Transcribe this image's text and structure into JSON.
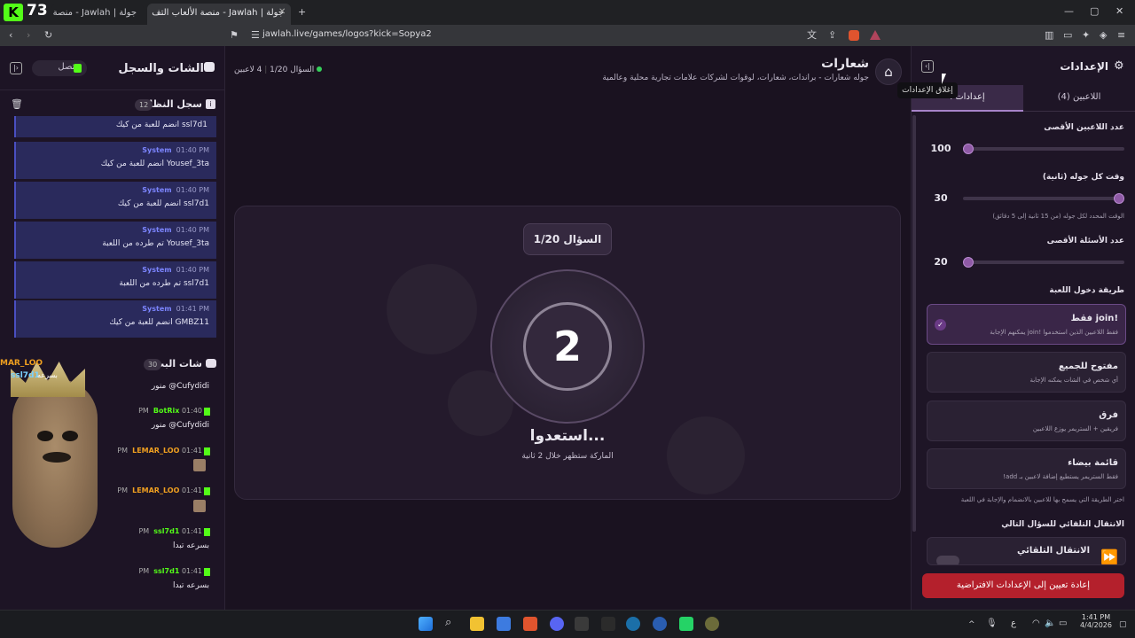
{
  "browser": {
    "logo_text": "73",
    "tabs": [
      {
        "title": "جولة | Jawlah - منصة الألعاب الت"
      },
      {
        "title": "جولة | Jawlah - منصة الألعاب التف"
      }
    ],
    "url": "jawlah.live/games/logos?kick=Sopya2"
  },
  "chat": {
    "title": "الشات والسجل",
    "status": "متصل",
    "system_log": {
      "title": "سجل النظام",
      "count": "12",
      "messages": [
        {
          "sender": "",
          "time": "",
          "text": "ssl7d1 انضم للعبة من كيك"
        },
        {
          "sender": "System",
          "time": "01:40 PM",
          "text": "Yousef_3ta انضم للعبة من كيك"
        },
        {
          "sender": "System",
          "time": "01:40 PM",
          "text": "ssl7d1 انضم للعبة من كيك"
        },
        {
          "sender": "System",
          "time": "01:40 PM",
          "text": "Yousef_3ta تم طرده من اللعبة"
        },
        {
          "sender": "System",
          "time": "01:40 PM",
          "text": "ssl7d1 تم طرده من اللعبة"
        },
        {
          "sender": "System",
          "time": "01:41 PM",
          "text": "GMBZ11 انضم للعبة من كيك"
        }
      ]
    },
    "broadcast": {
      "title": "شات البث",
      "count": "30",
      "overlay_names": [
        "MAR_LOO",
        "ssl7d1"
      ],
      "overlay_text": "بسرعه",
      "messages": [
        {
          "user": "",
          "time": "",
          "text": "Cufydidi@ منور"
        },
        {
          "user": "BotRix",
          "time": "01:40 PM",
          "text": "Cufydidi@ منور"
        },
        {
          "user": "LEMAR_LOO",
          "time": "01:41 PM",
          "text": ""
        },
        {
          "user": "LEMAR_LOO",
          "time": "01:41 PM",
          "text": ""
        },
        {
          "user": "ssl7d1",
          "time": "01:41 PM",
          "text": "بسرعه تبدا"
        },
        {
          "user": "ssl7d1",
          "time": "01:41 PM",
          "text": "بسرعه تبدا"
        }
      ]
    }
  },
  "game": {
    "title": "شعارات",
    "subtitle": "جوله شعارات - براندات، شعارات، لوقوات لشركات علامات تجارية محلية وعالمية",
    "players": "4 لاعبين",
    "question_header": "السؤال 1/20",
    "question_pill": "السؤال 1/20",
    "countdown": "2",
    "ready": "استعدوا...",
    "ready_sub": "الماركة ستظهر خلال 2 ثانية"
  },
  "settings": {
    "title": "الإعدادات",
    "tooltip": "إغلاق الإعدادات",
    "tab_players": "اللاعبين (4)",
    "tab_settings": "إعدادات ا",
    "max_players": {
      "label": "عدد اللاعبين الأقصى",
      "value": "100",
      "level": 0.0
    },
    "round_time": {
      "label": "وقت كل جوله (ثانية)",
      "value": "30",
      "hint": "الوقت المحدد لكل جوله (من 15 ثانية إلى 5 دقائق)",
      "level": 1.0
    },
    "max_questions": {
      "label": "عدد الأسئلة الأقصى",
      "value": "20",
      "level": 0.0
    },
    "join_method_label": "طريقة دخول اللعبة",
    "options": [
      {
        "title": "!join فقط",
        "desc": "فقط اللاعبين الذين استخدموا !join يمكنهم الإجابة",
        "selected": true
      },
      {
        "title": "مفتوح للجميع",
        "desc": "أي شخص في الشات يمكنه الإجابة",
        "selected": false
      },
      {
        "title": "فرق",
        "desc": "فريقين + الستريمر يوزع اللاعبين",
        "selected": false
      },
      {
        "title": "قائمة بيضاء",
        "desc": "فقط الستريمر يستطيع إضافة لاعبين بـ add!",
        "selected": false
      }
    ],
    "join_hint": "اختر الطريقة التي يسمح بها للاعبين بالانضمام والإجابة في اللعبة",
    "auto_next_label": "الانتقال التلقائي للسؤال التالي",
    "auto_next_option": "الانتقال التلقائي",
    "reset_button": "إعادة تعيين إلى الإعدادات الافتراضية"
  },
  "taskbar": {
    "time": "1:41 PM",
    "date": "4/4/2026",
    "lang": "ع"
  }
}
